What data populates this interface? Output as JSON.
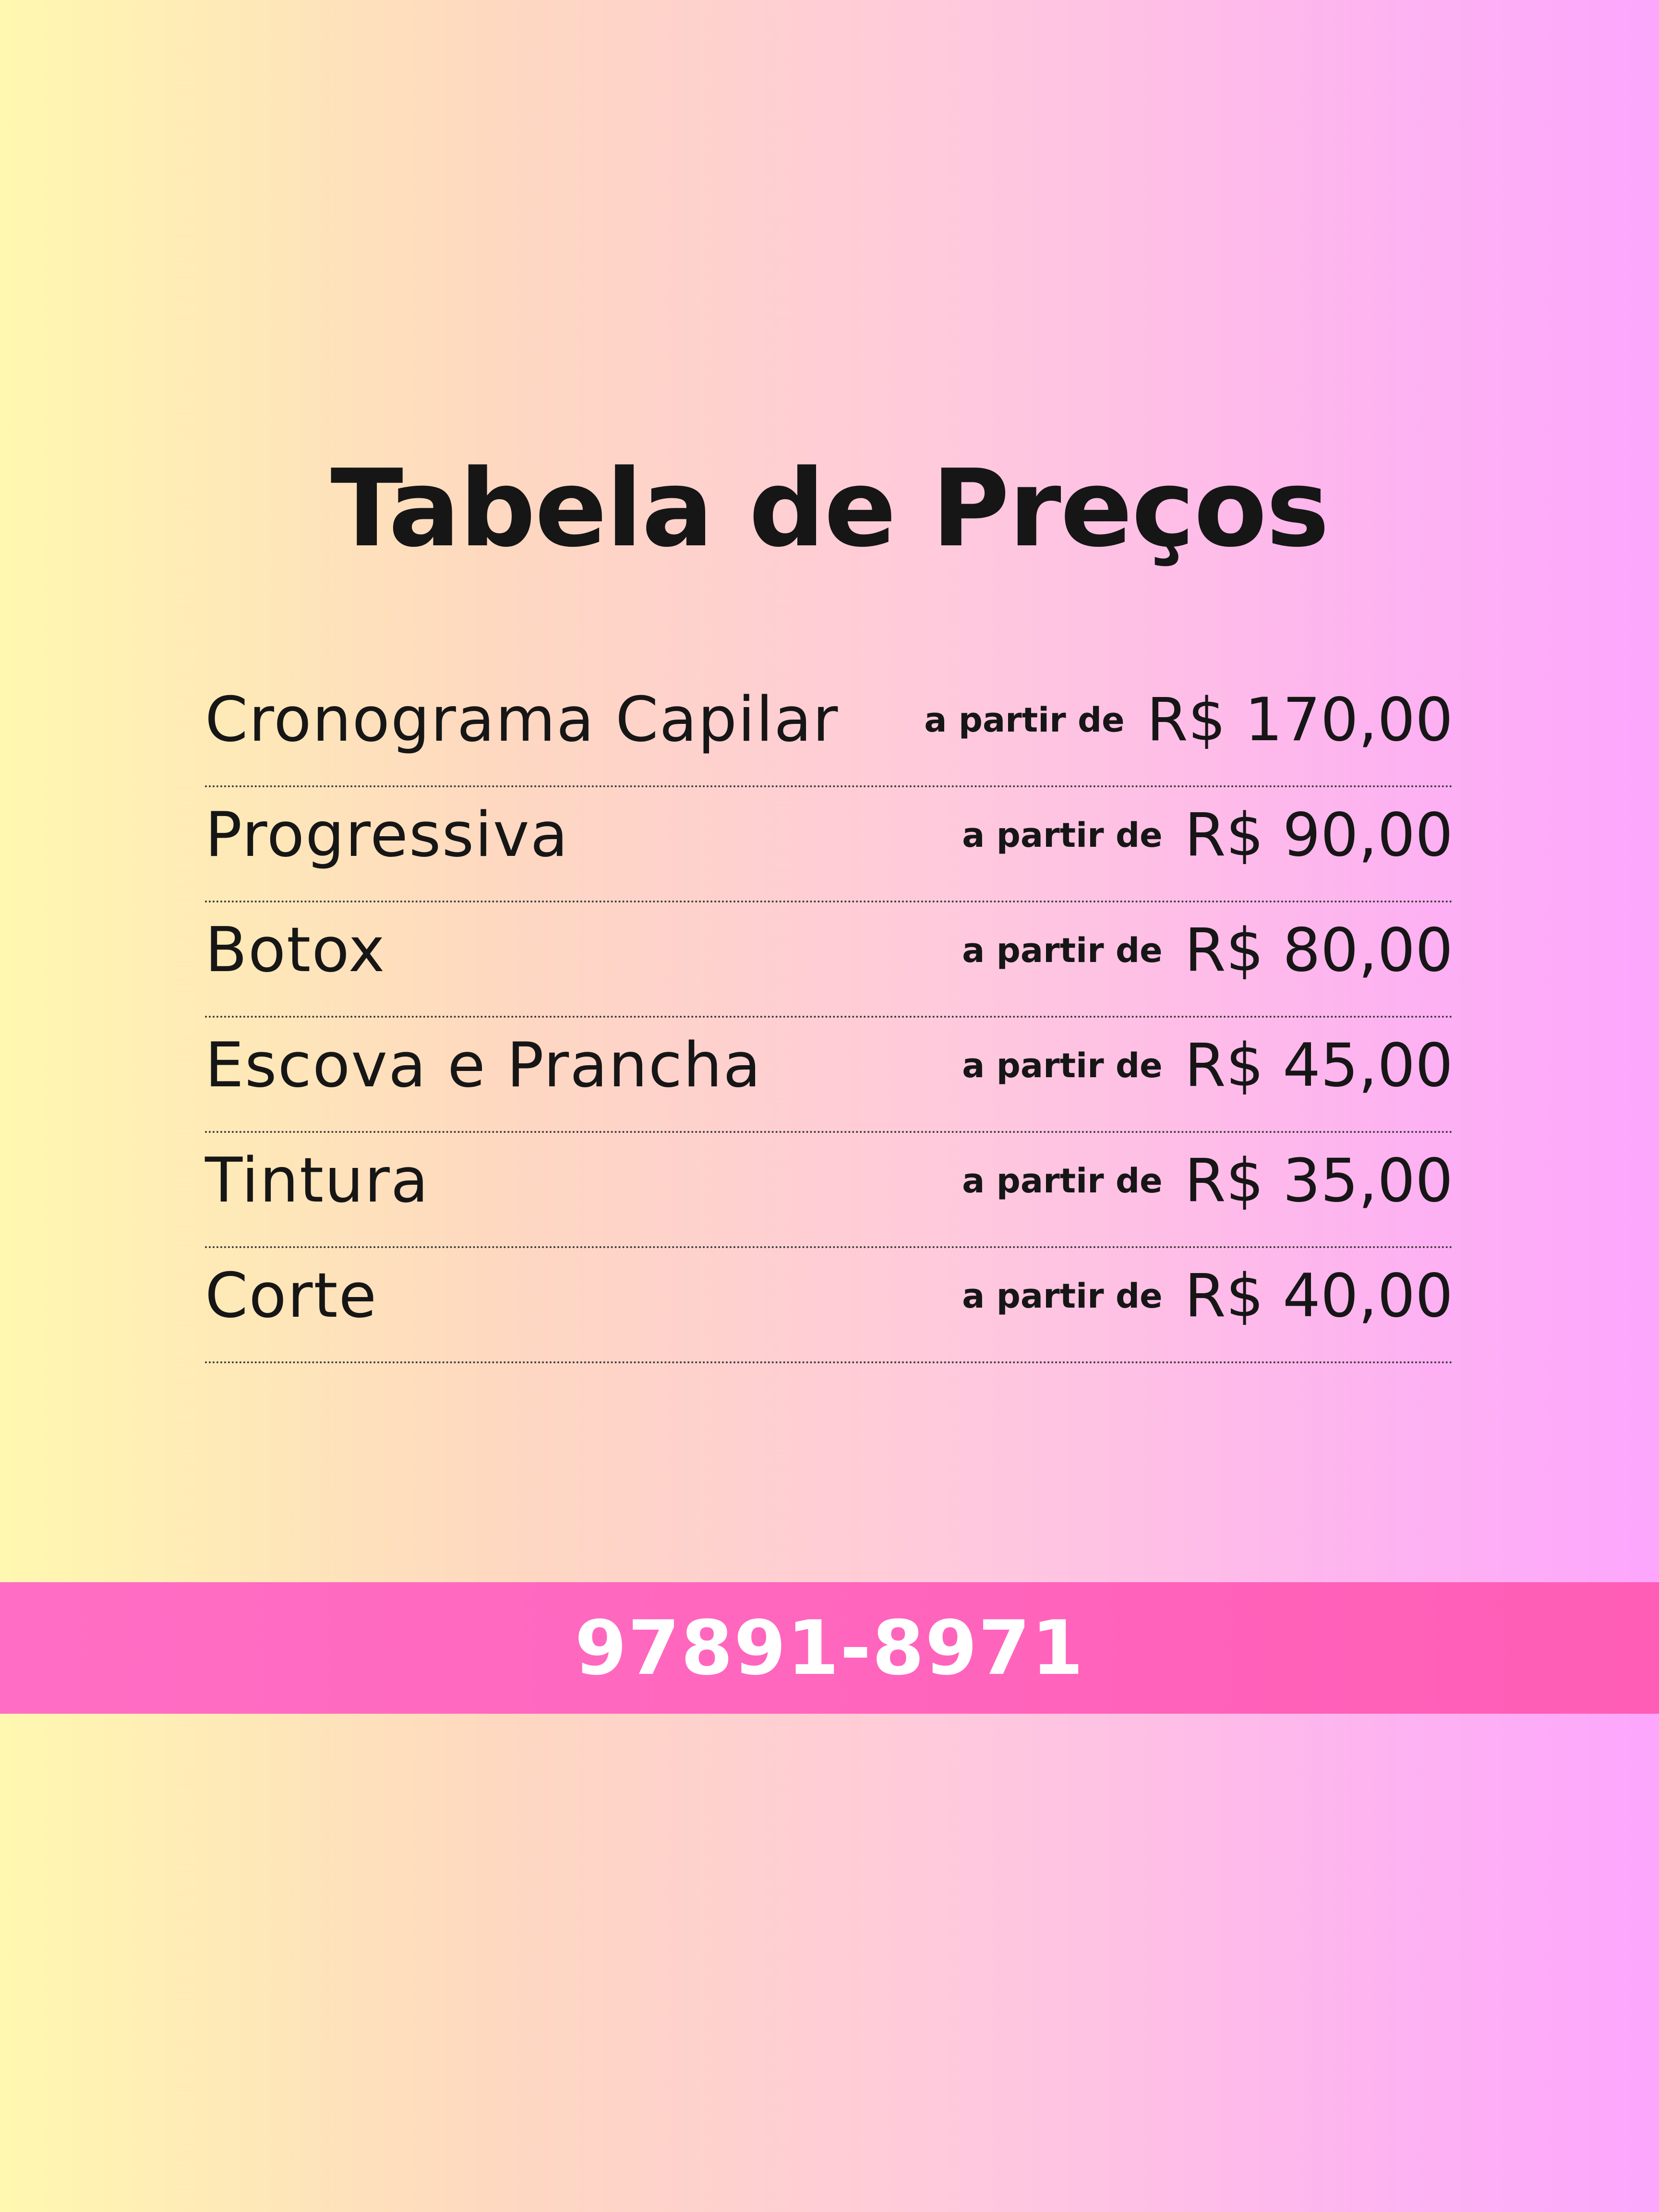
{
  "title": "Tabela de Preços",
  "price_list": {
    "items": [
      {
        "service": "Cronograma Capilar",
        "from_label": "a partir de",
        "price": "R$ 170,00"
      },
      {
        "service": "Progressiva",
        "from_label": "a partir de",
        "price": "R$ 90,00"
      },
      {
        "service": "Botox",
        "from_label": "a partir de",
        "price": "R$ 80,00"
      },
      {
        "service": "Escova e Prancha",
        "from_label": "a partir de",
        "price": "R$ 45,00"
      },
      {
        "service": "Tintura",
        "from_label": "a partir de",
        "price": "R$ 35,00"
      },
      {
        "service": "Corte",
        "from_label": "a partir de",
        "price": "R$ 40,00"
      }
    ]
  },
  "contact": {
    "phone": "97891-8971"
  },
  "colors": {
    "gradient_left": "#fff8b0",
    "gradient_right": "#fda6fd",
    "band": "#ff63be",
    "text": "#161616",
    "phone_text": "#ffffff"
  }
}
